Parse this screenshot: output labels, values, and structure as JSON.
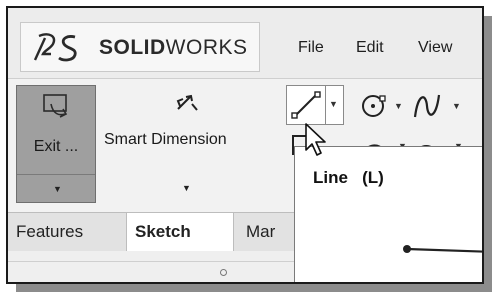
{
  "app": {
    "brand_bold": "SOLID",
    "brand_light": "WORKS",
    "menu": [
      "File",
      "Edit",
      "View"
    ]
  },
  "ribbon": {
    "exit_label": "Exit ...",
    "smart_dimension_label": "Smart Dimension"
  },
  "tabs": [
    {
      "label": "Features",
      "active": false
    },
    {
      "label": "Sketch",
      "active": true
    },
    {
      "label": "Mar",
      "active": false
    }
  ],
  "tooltip": {
    "title": "Line   (L)"
  },
  "icons": [
    "ds-logo-icon",
    "exit-sketch-icon",
    "smart-dimension-icon",
    "line-tool-icon",
    "circle-tool-icon",
    "spline-tool-icon",
    "rectangle-tool-icon",
    "arc-tool-icon",
    "mouse-pointer-icon"
  ],
  "colors": {
    "exit_button_bg": "#9f9f9f",
    "active_tab_bg": "#ffffff"
  }
}
